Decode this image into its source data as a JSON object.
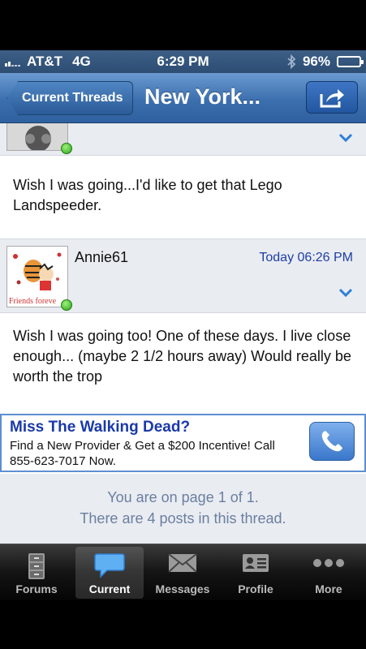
{
  "status_bar": {
    "carrier": "AT&T",
    "network": "4G",
    "time": "6:29 PM",
    "battery": "96%",
    "battery_level": 0.96
  },
  "nav": {
    "back_label": "Current Threads",
    "title": "New York..."
  },
  "posts": [
    {
      "body": "Wish I was going...I'd like to get that Lego Landspeeder."
    },
    {
      "username": "Annie61",
      "time": "Today 06:26 PM",
      "avatar_caption": "Friends foreve",
      "body": "Wish I was going too!  One of these days. I live close enough... (maybe 2 1/2 hours away) Would really be worth the trop"
    }
  ],
  "ad": {
    "title": "Miss The Walking Dead?",
    "text": "Find a New Provider & Get a $200 Incentive! Call 855-623-7017 Now."
  },
  "page_info": {
    "line1": "You are on page 1 of 1.",
    "line2": "There are 4 posts in this thread."
  },
  "tabs": [
    {
      "label": "Forums",
      "icon": "cabinet-icon"
    },
    {
      "label": "Current",
      "icon": "chat-bubble-icon",
      "active": true
    },
    {
      "label": "Messages",
      "icon": "envelope-icon"
    },
    {
      "label": "Profile",
      "icon": "id-card-icon"
    },
    {
      "label": "More",
      "icon": "more-dots-icon"
    }
  ],
  "colors": {
    "nav_blue": "#3c6fae",
    "link_blue": "#1f3ea6",
    "online_green": "#2ea21b"
  }
}
